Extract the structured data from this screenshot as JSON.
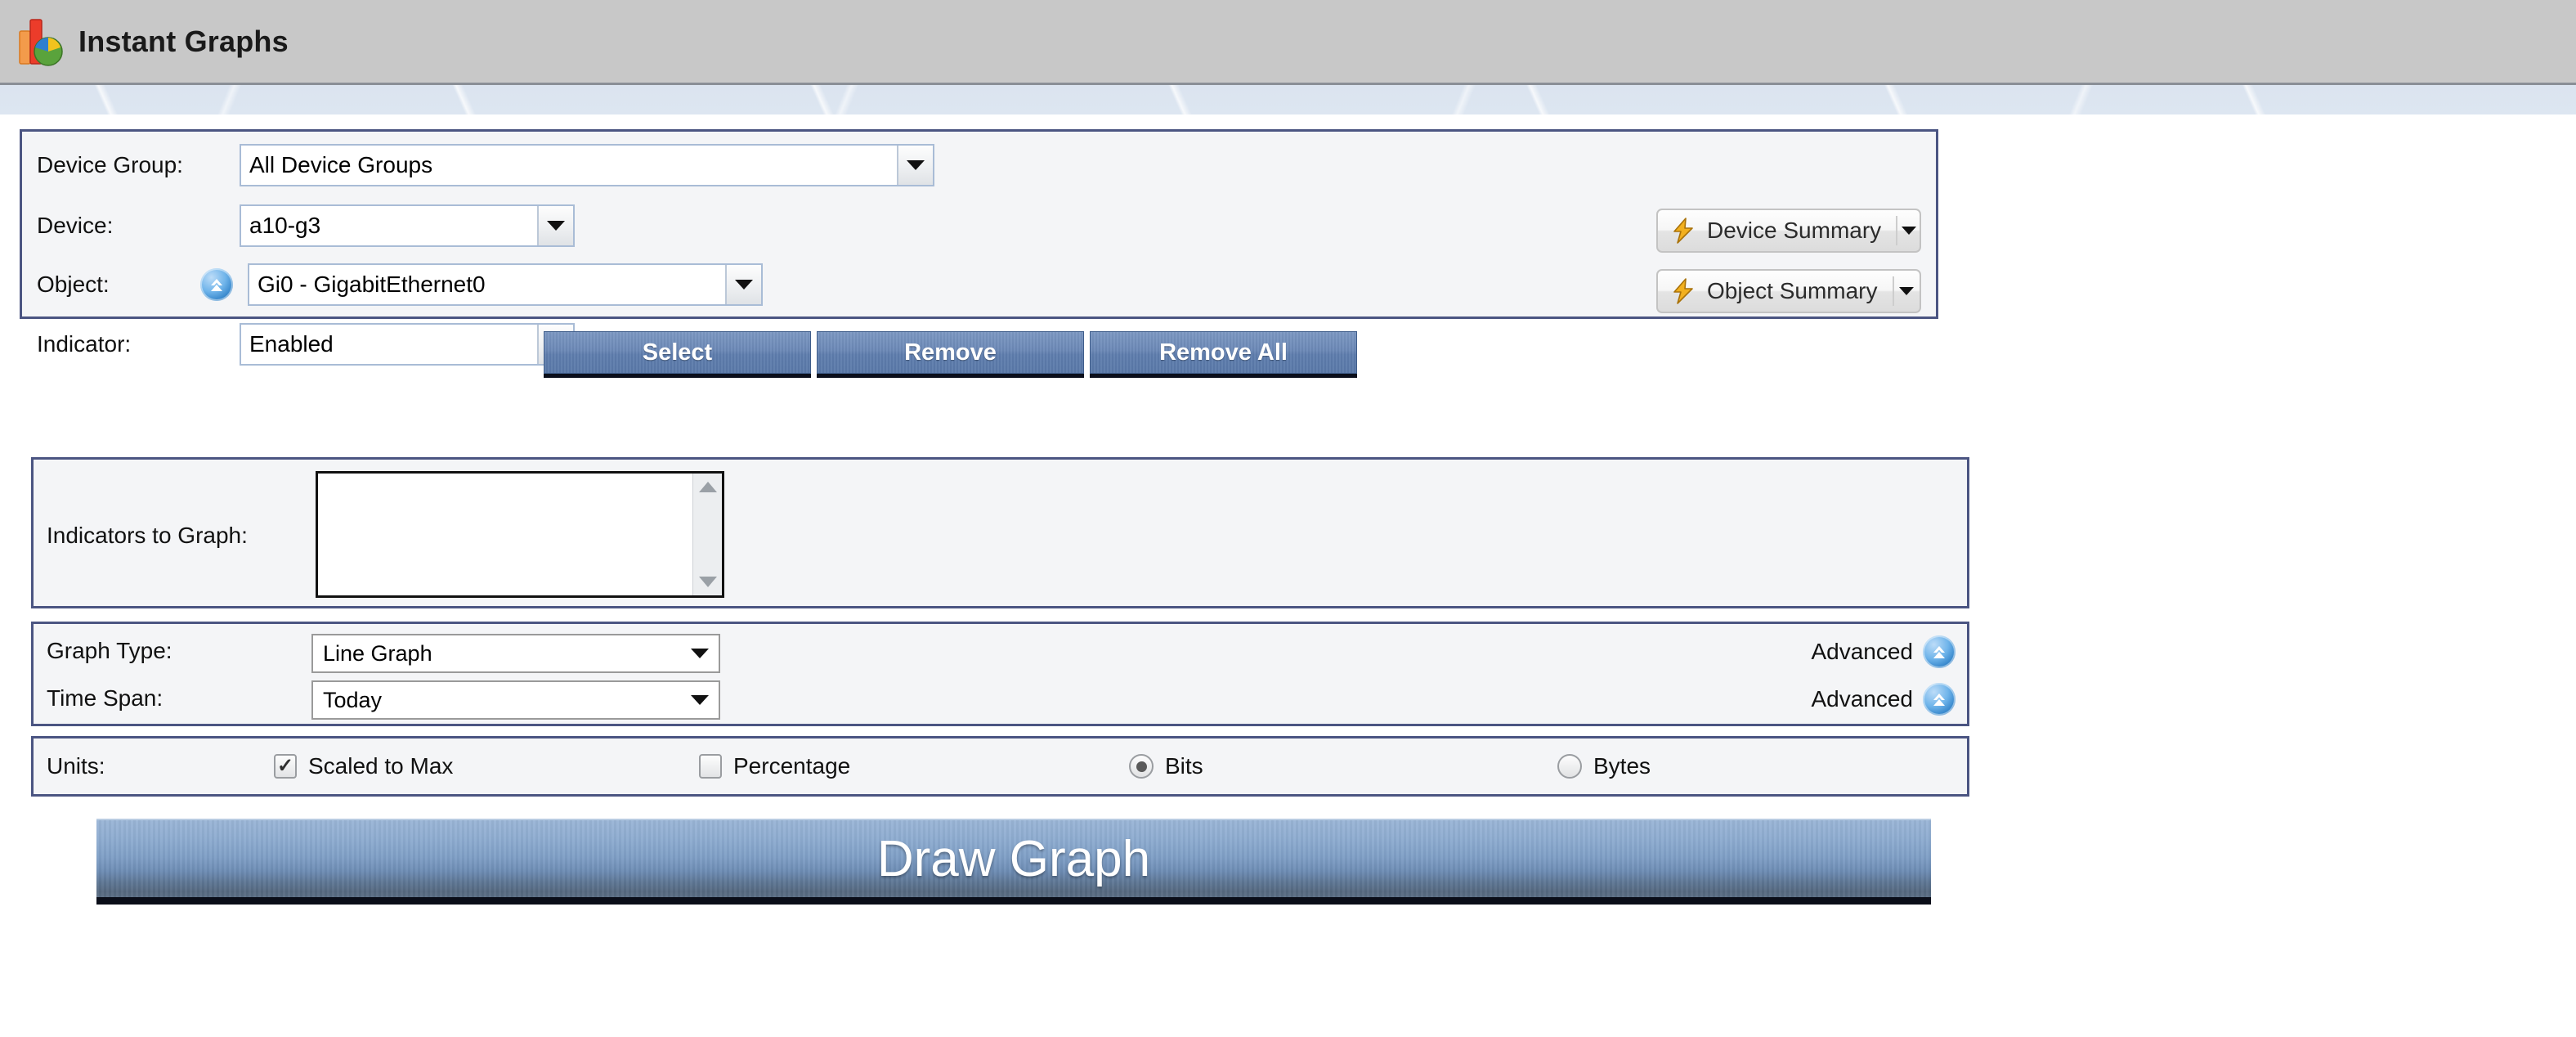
{
  "titlebar": {
    "title": "Instant Graphs",
    "logo_icon": "bar-pie-chart-icon"
  },
  "form": {
    "device_group": {
      "label": "Device Group:",
      "value": "All Device Groups",
      "arrow_icon": "chevron-down-icon"
    },
    "device": {
      "label": "Device:",
      "value": "a10-g3",
      "arrow_icon": "chevron-down-icon"
    },
    "object": {
      "label": "Object:",
      "value": "Gi0 - GigabitEthernet0",
      "expand_icon": "blue-up-arrow-icon",
      "arrow_icon": "chevron-down-icon"
    },
    "indicator": {
      "label": "Indicator:",
      "value": "Enabled",
      "arrow_icon": "chevron-down-icon"
    },
    "device_summary_button": {
      "label": "Device Summary",
      "icon": "lightning-bolt-icon",
      "caret_icon": "chevron-down-icon"
    },
    "object_summary_button": {
      "label": "Object Summary",
      "icon": "lightning-bolt-icon",
      "caret_icon": "chevron-down-icon"
    }
  },
  "actions": {
    "select": "Select",
    "remove": "Remove",
    "remove_all": "Remove All"
  },
  "indicators": {
    "label": "Indicators to Graph:",
    "items": [],
    "scroll_up_icon": "scroll-up-arrow-icon",
    "scroll_down_icon": "scroll-down-arrow-icon"
  },
  "graph_options": {
    "graph_type": {
      "label": "Graph Type:",
      "value": "Line Graph",
      "arrow_icon": "chevron-down-icon"
    },
    "time_span": {
      "label": "Time Span:",
      "value": "Today",
      "arrow_icon": "chevron-down-icon"
    },
    "advanced_graph_type": {
      "label": "Advanced",
      "icon": "blue-up-arrow-icon"
    },
    "advanced_time_span": {
      "label": "Advanced",
      "icon": "blue-up-arrow-icon"
    }
  },
  "units": {
    "label": "Units:",
    "scaled_to_max": {
      "label": "Scaled to Max",
      "checked": true
    },
    "percentage": {
      "label": "Percentage",
      "checked": false
    },
    "bits": {
      "label": "Bits",
      "selected": true
    },
    "bytes": {
      "label": "Bytes",
      "selected": false
    }
  },
  "draw_graph": {
    "label": "Draw Graph"
  },
  "colors": {
    "panel_border": "#4b5582",
    "panel_bg": "#f4f5f7",
    "titlebar_bg": "#c8c8c8",
    "strip_bg": "#dce5f0",
    "action_button": "#6b88b6",
    "draw_button_top": "#9ab5d6",
    "draw_button_bottom": "#55687f"
  }
}
